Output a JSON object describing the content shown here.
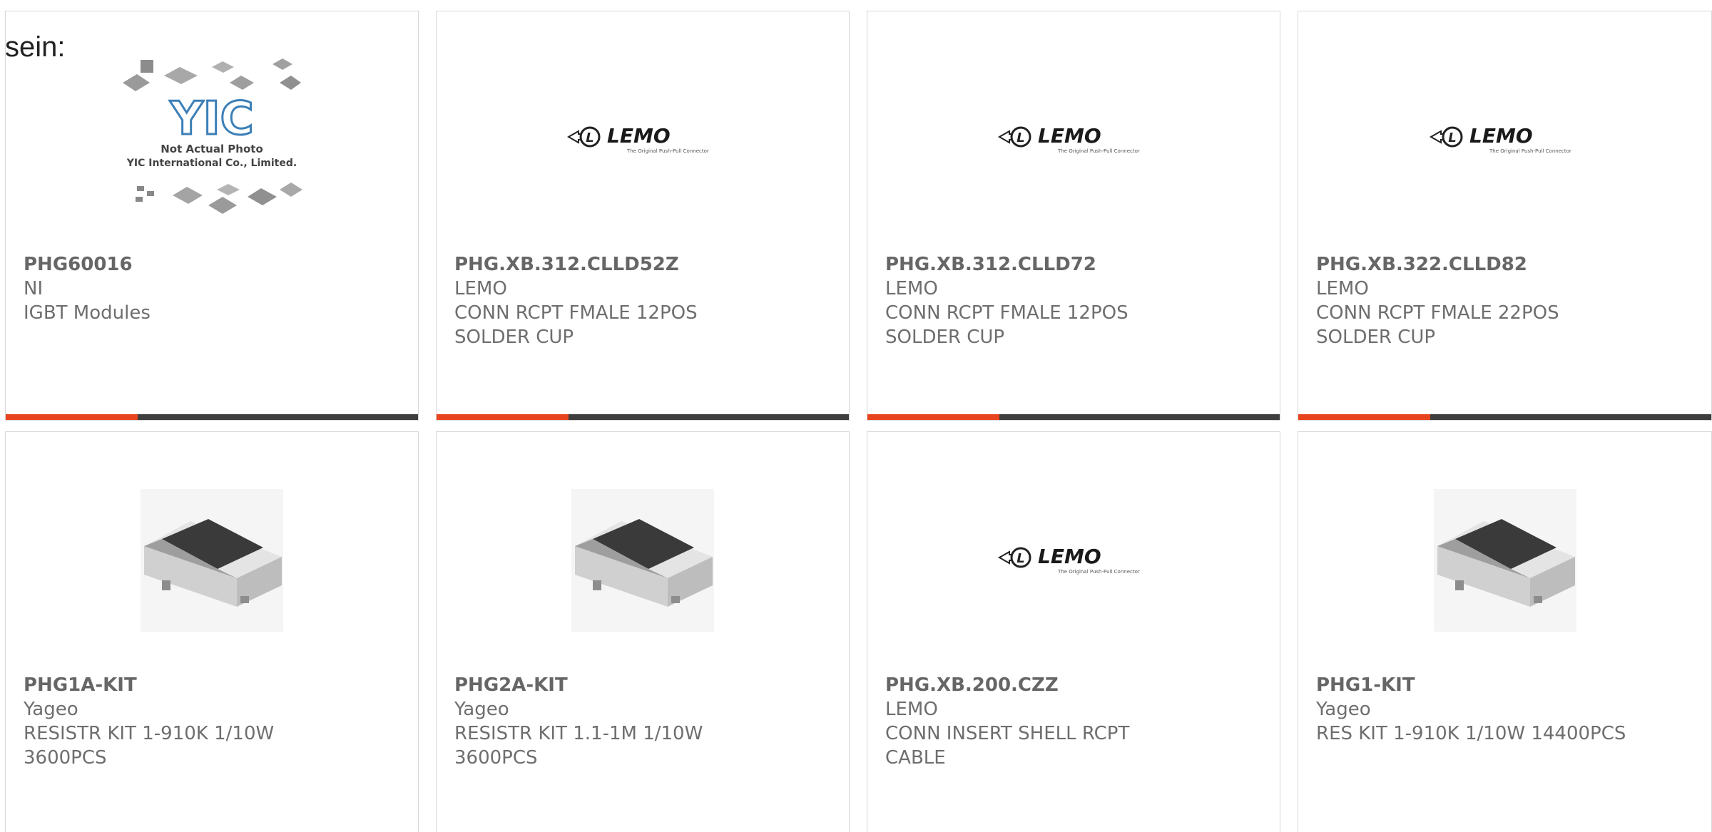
{
  "intro_text": "sein:",
  "colors": {
    "accent": "#e8451e",
    "bar_dark": "#3e3e3e",
    "border": "#d7d7d7",
    "text": "#6e6e6e"
  },
  "yic_notice": {
    "line1": "Not Actual Photo",
    "line2": "YIC International Co., Limited.",
    "logo": "YIC"
  },
  "lemo_logo": {
    "brand": "LEMO",
    "tagline": "The Original Push-Pull Connector"
  },
  "products": [
    {
      "part_number": "PHG60016",
      "manufacturer": "NI",
      "desc1": "IGBT Modules",
      "desc2": "",
      "image": "not-actual-photo"
    },
    {
      "part_number": "PHG.XB.312.CLLD52Z",
      "manufacturer": "LEMO",
      "desc1": "CONN RCPT FMALE 12POS",
      "desc2": "SOLDER CUP",
      "image": "lemo-logo"
    },
    {
      "part_number": "PHG.XB.312.CLLD72",
      "manufacturer": "LEMO",
      "desc1": "CONN RCPT FMALE 12POS",
      "desc2": "SOLDER CUP",
      "image": "lemo-logo"
    },
    {
      "part_number": "PHG.XB.322.CLLD82",
      "manufacturer": "LEMO",
      "desc1": "CONN RCPT FMALE 22POS",
      "desc2": "SOLDER CUP",
      "image": "lemo-logo"
    },
    {
      "part_number": "PHG1A-KIT",
      "manufacturer": "Yageo",
      "desc1": "RESISTR KIT 1-910K 1/10W",
      "desc2": "3600PCS",
      "image": "chip-resistor"
    },
    {
      "part_number": "PHG2A-KIT",
      "manufacturer": "Yageo",
      "desc1": "RESISTR KIT 1.1-1M 1/10W",
      "desc2": "3600PCS",
      "image": "chip-resistor"
    },
    {
      "part_number": "PHG.XB.200.CZZ",
      "manufacturer": "LEMO",
      "desc1": "CONN INSERT SHELL RCPT",
      "desc2": "CABLE",
      "image": "lemo-logo"
    },
    {
      "part_number": "PHG1-KIT",
      "manufacturer": "Yageo",
      "desc1": "RES KIT 1-910K 1/10W 14400PCS",
      "desc2": "",
      "image": "chip-resistor"
    }
  ]
}
